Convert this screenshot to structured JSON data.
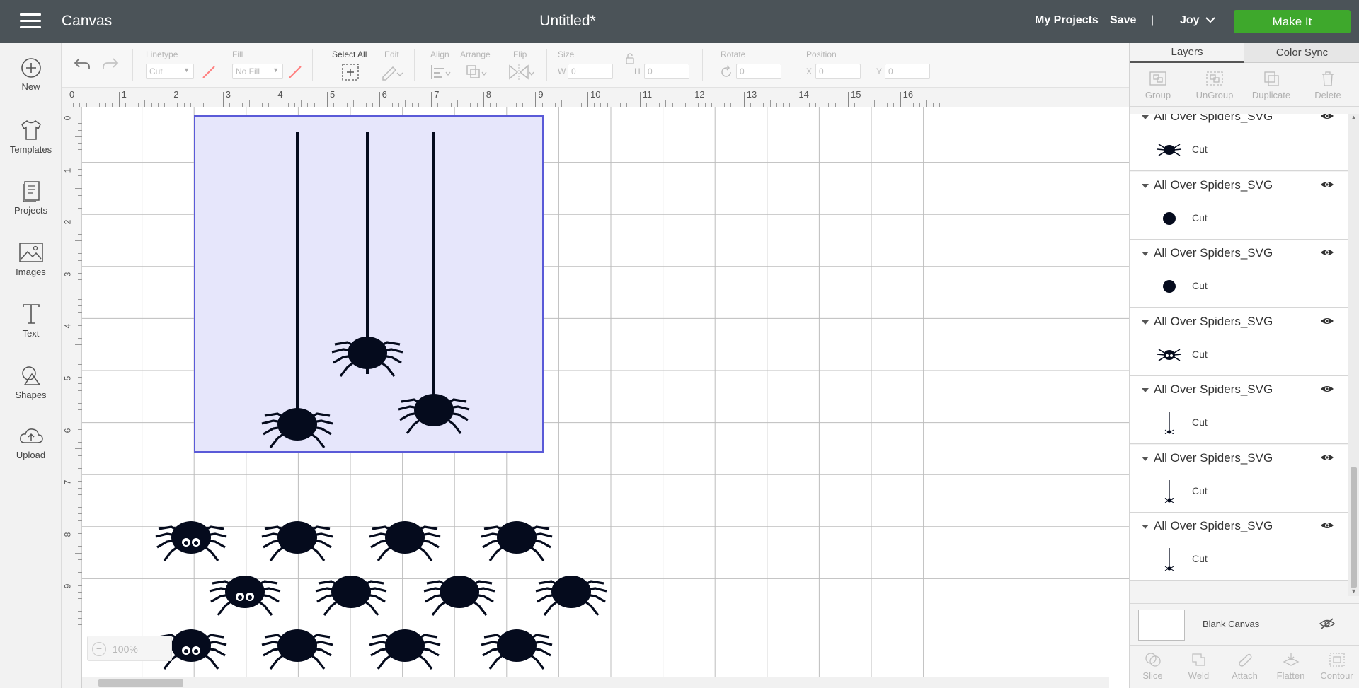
{
  "topbar": {
    "app_title": "Canvas",
    "doc_title": "Untitled*",
    "my_projects": "My Projects",
    "save": "Save",
    "separator": "|",
    "user": "Joy",
    "make_it": "Make It",
    "make_it_color": "#3ea82c",
    "background_color": "#4b5358"
  },
  "sidebar": {
    "items": [
      {
        "label": "New",
        "icon": "plus-circle-icon"
      },
      {
        "label": "Templates",
        "icon": "tshirt-icon"
      },
      {
        "label": "Projects",
        "icon": "projects-icon"
      },
      {
        "label": "Images",
        "icon": "image-icon"
      },
      {
        "label": "Text",
        "icon": "text-icon"
      },
      {
        "label": "Shapes",
        "icon": "shapes-icon"
      },
      {
        "label": "Upload",
        "icon": "upload-cloud-icon"
      }
    ]
  },
  "toolbar": {
    "linetype_label": "Linetype",
    "linetype_value": "Cut",
    "fill_label": "Fill",
    "fill_value": "No Fill",
    "select_all_label": "Select All",
    "edit_label": "Edit",
    "align_label": "Align",
    "arrange_label": "Arrange",
    "flip_label": "Flip",
    "size_label": "Size",
    "w_label": "W",
    "w_value": "0",
    "h_label": "H",
    "h_value": "0",
    "rotate_label": "Rotate",
    "rotate_value": "0",
    "position_label": "Position",
    "x_label": "X",
    "x_value": "0",
    "y_label": "Y",
    "y_value": "0"
  },
  "canvas": {
    "ruler_h_ticks": [
      "0",
      "1",
      "2",
      "3",
      "4",
      "5",
      "6",
      "7",
      "8",
      "9",
      "10",
      "11",
      "12",
      "13",
      "14",
      "15",
      "16"
    ],
    "ruler_v_ticks": [
      "0",
      "1",
      "2",
      "3",
      "4",
      "5",
      "6",
      "7",
      "8",
      "9"
    ],
    "zoom": "100%",
    "selection_color": "#5a5ad8",
    "selection_fill": "#e6e6fb"
  },
  "panel": {
    "tabs": [
      "Layers",
      "Color Sync"
    ],
    "actions": [
      "Group",
      "UnGroup",
      "Duplicate",
      "Delete"
    ],
    "layers": [
      {
        "name": "All Over Spiders_SVG",
        "sub": "Cut",
        "thumb": "spider"
      },
      {
        "name": "All Over Spiders_SVG",
        "sub": "Cut",
        "thumb": "circle"
      },
      {
        "name": "All Over Spiders_SVG",
        "sub": "Cut",
        "thumb": "circle"
      },
      {
        "name": "All Over Spiders_SVG",
        "sub": "Cut",
        "thumb": "spider-eyes"
      },
      {
        "name": "All Over Spiders_SVG",
        "sub": "Cut",
        "thumb": "hanging"
      },
      {
        "name": "All Over Spiders_SVG",
        "sub": "Cut",
        "thumb": "hanging"
      },
      {
        "name": "All Over Spiders_SVG",
        "sub": "Cut",
        "thumb": "hanging"
      }
    ],
    "blank_canvas": "Blank Canvas",
    "bottom_actions": [
      "Slice",
      "Weld",
      "Attach",
      "Flatten",
      "Contour"
    ]
  }
}
